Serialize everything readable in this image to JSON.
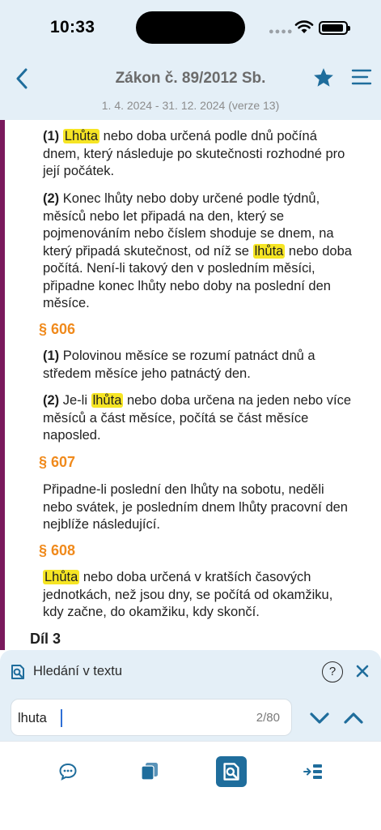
{
  "status_bar": {
    "time": "10:33",
    "icons": [
      "signal-dots-icon",
      "wifi-icon",
      "battery-icon"
    ]
  },
  "header": {
    "title": "Zákon č. 89/2012 Sb.",
    "version": "1. 4. 2024 - 31. 12. 2024 (verze 13)",
    "icons": [
      "chevron-left-icon",
      "star-icon",
      "menu-icon"
    ]
  },
  "colors": {
    "accent": "#1f6d9c",
    "section": "#f08a1c",
    "highlight": "#f6e524",
    "sidebar_bar": "#7a1a5d",
    "panel": "#e4eff7"
  },
  "content": {
    "p605_1": {
      "num": "(1)",
      "hl": "Lhůta",
      "line1": " nebo doba určená podle dnů počíná",
      "line2": "dnem, který následuje po skutečnosti rozhodné pro",
      "line3": "její počátek."
    },
    "p605_2": {
      "num": "(2)",
      "line1": " Konec lhůty nebo doby určené podle týdnů,",
      "line2": "měsíců nebo let připadá na den, který se",
      "line3": "pojmenováním nebo číslem shoduje se dnem, na",
      "line4a": "který připadá skutečnost, od níž se ",
      "hl": "lhůta",
      "line4b": " nebo doba",
      "line5": "počítá. Není-li takový den v posledním měsíci,",
      "line6": "připadne konec lhůty nebo doby na poslední den",
      "line7": "měsíce."
    },
    "s606": "§ 606",
    "p606_1": {
      "num": "(1)",
      "line1": " Polovinou měsíce se rozumí patnáct dnů a",
      "line2": "středem měsíce jeho patnáctý den."
    },
    "p606_2": {
      "num": "(2)",
      "line1a": " Je-li ",
      "hl": "lhůta",
      "line1b": " nebo doba určena na jeden nebo více",
      "line2": "měsíců a část měsíce, počítá se část měsíce",
      "line3": "naposled."
    },
    "s607": "§ 607",
    "p607": {
      "line1": "Připadne-li poslední den lhůty na sobotu, neděli",
      "line2": "nebo svátek, je posledním dnem lhůty pracovní den",
      "line3": "nejblíže následující."
    },
    "s608": "§ 608",
    "p608": {
      "hl": "Lhůta",
      "line1": " nebo doba určená v kratších časových",
      "line2": "jednotkách, než jsou dny, se počítá od okamžiku,",
      "line3": "kdy začne, do okamžiku, kdy skončí."
    },
    "dil": "Díl 3"
  },
  "search": {
    "title": "Hledání v textu",
    "help": "?",
    "value": "lhuta",
    "count": "2/80",
    "icons": [
      "document-search-icon",
      "help-icon",
      "close-icon",
      "chevron-down-icon",
      "chevron-up-icon"
    ]
  },
  "tab_bar": {
    "icons": [
      "comment-icon",
      "layers-icon",
      "document-search-icon",
      "indent-list-icon"
    ],
    "active": "document-search-icon"
  }
}
